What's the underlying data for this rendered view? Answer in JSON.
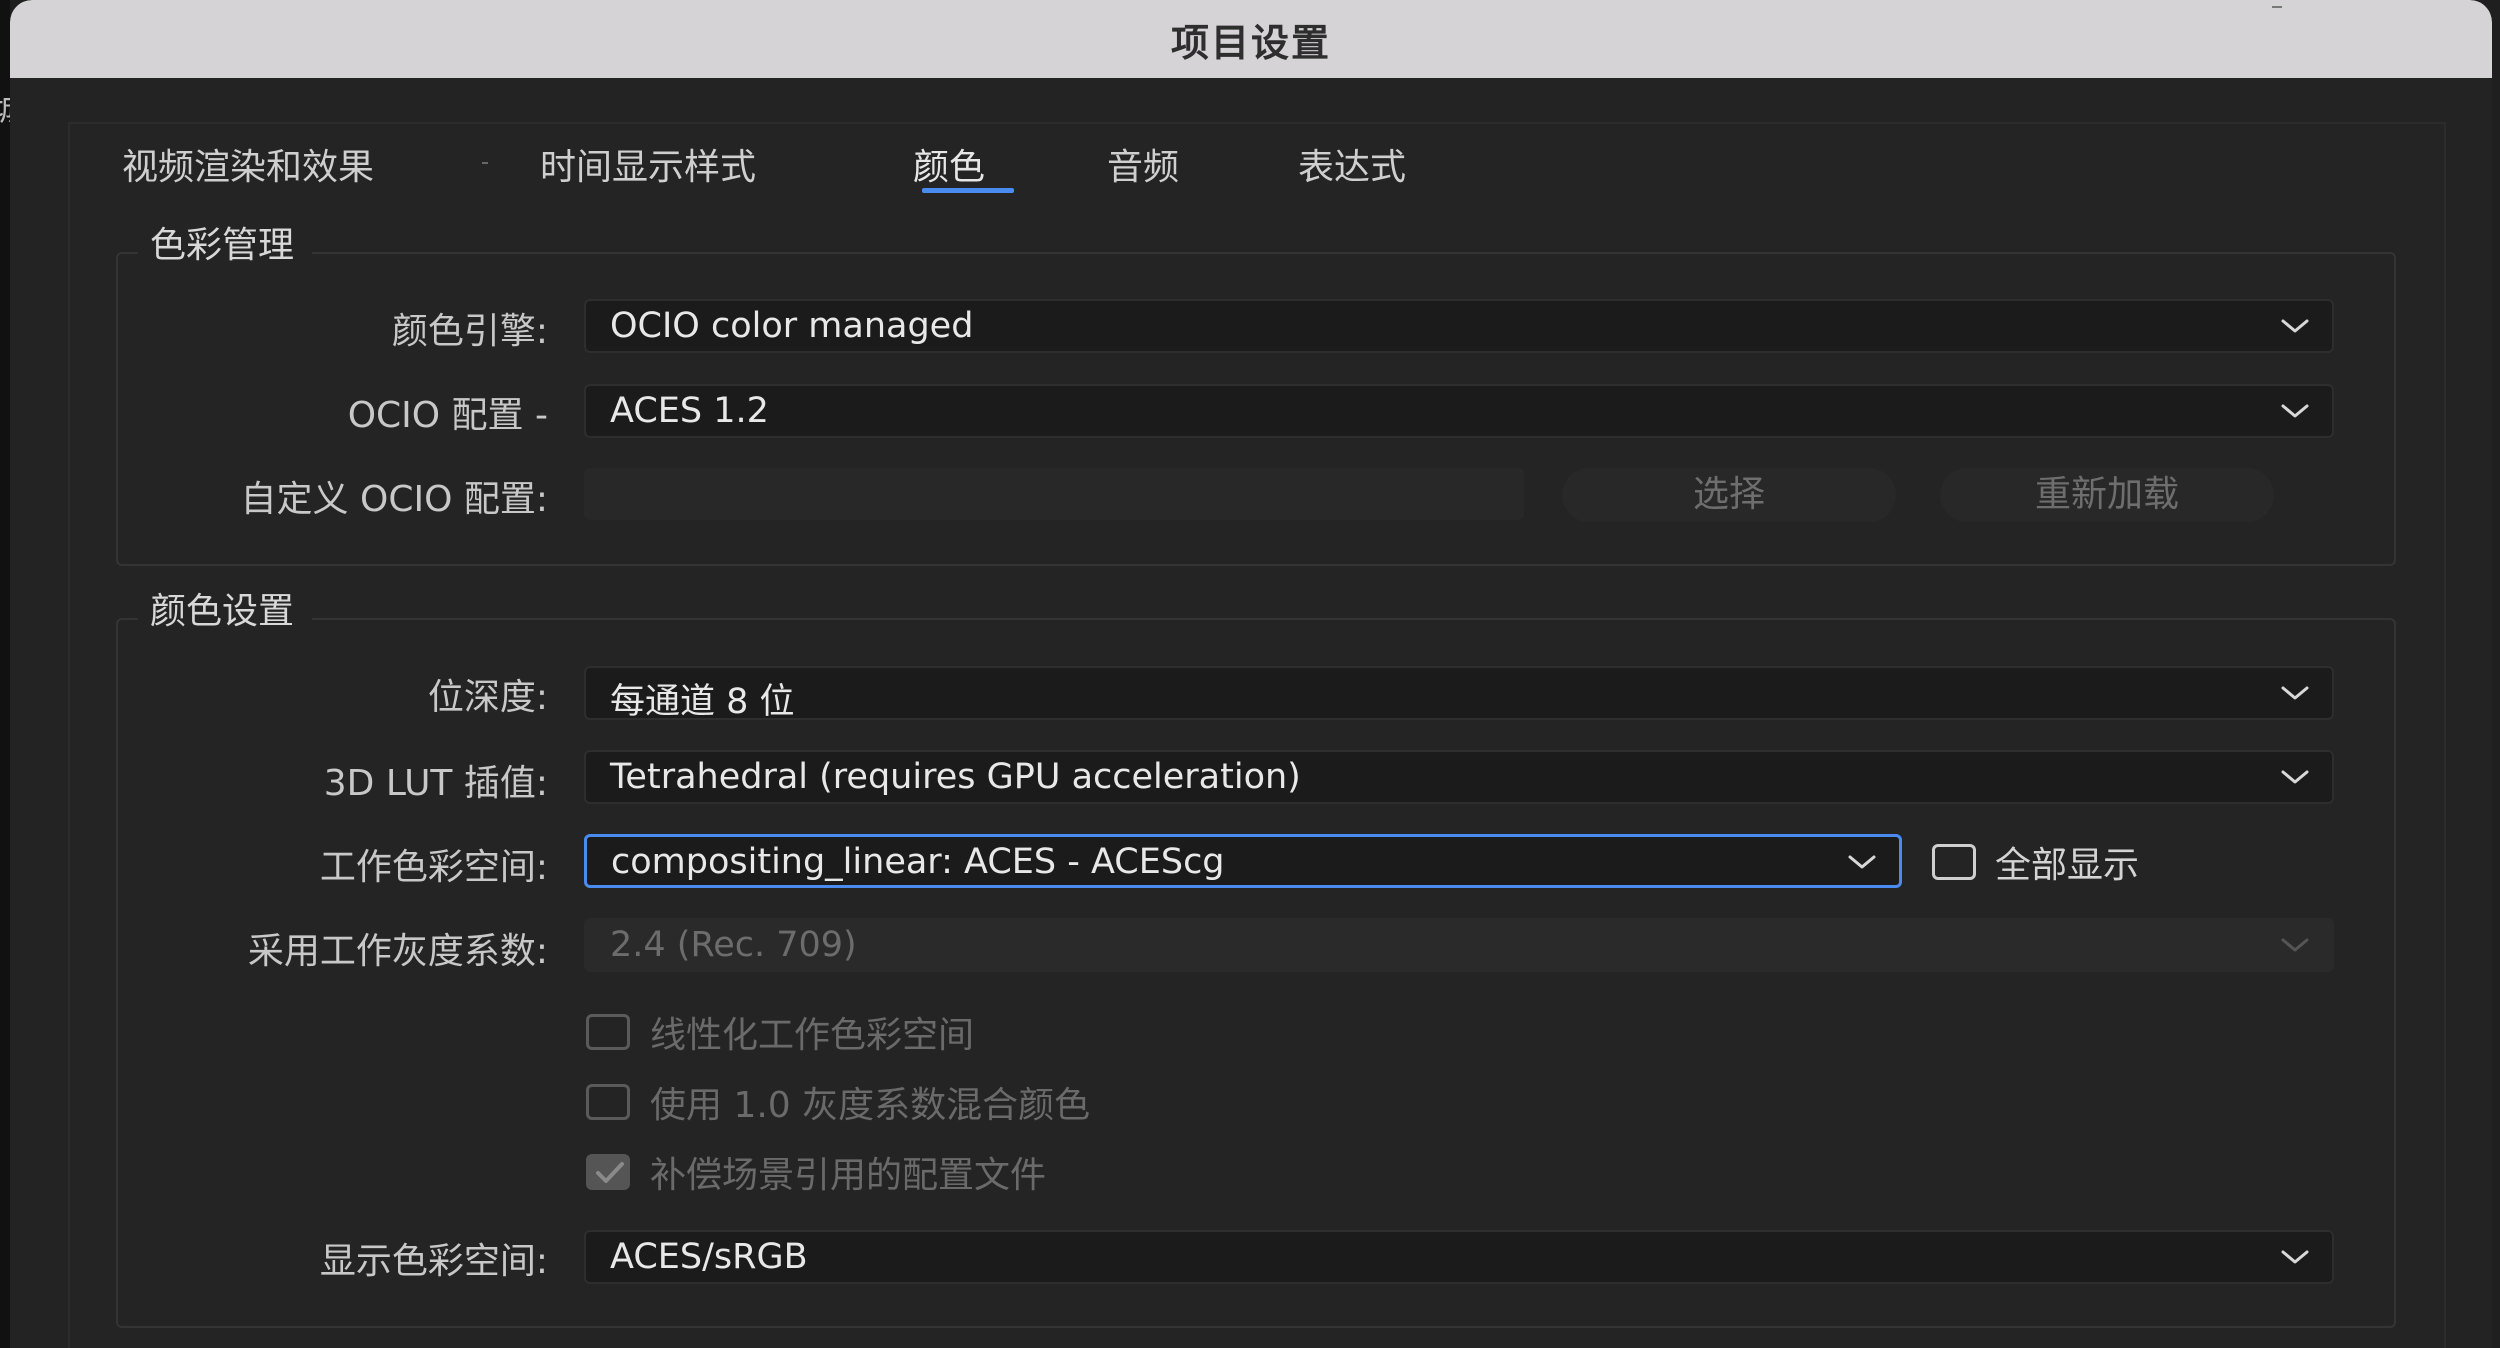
{
  "window": {
    "title": "项目设置",
    "left_edge_glyph": "城"
  },
  "tabs": [
    {
      "label": "视频渲染和效果",
      "active": false
    },
    {
      "label": "时间显示样式",
      "active": false
    },
    {
      "label": "颜色",
      "active": true
    },
    {
      "label": "音频",
      "active": false
    },
    {
      "label": "表达式",
      "active": false
    }
  ],
  "color_management": {
    "title": "色彩管理",
    "engine_label": "颜色引擎:",
    "engine_value": "OCIO color managed",
    "ocio_config_label": "OCIO 配置 -",
    "ocio_config_value": "ACES 1.2",
    "custom_config_label": "自定义 OCIO 配置:",
    "custom_config_value": "",
    "choose_button": "选择",
    "reload_button": "重新加载"
  },
  "color_settings": {
    "title": "颜色设置",
    "bit_depth_label": "位深度:",
    "bit_depth_value": "每通道 8 位",
    "lut_label": "3D LUT 插值:",
    "lut_value": "Tetrahedral (requires GPU acceleration)",
    "working_space_label": "工作色彩空间:",
    "working_space_value": "compositing_linear: ACES - ACEScg",
    "show_all_label": "全部显示",
    "show_all_checked": false,
    "gamma_label": "采用工作灰度系数:",
    "gamma_value": "2.4 (Rec. 709)",
    "linearize_label": "线性化工作色彩空间",
    "linearize_checked": false,
    "blend_gamma_label": "使用 1.0 灰度系数混合颜色",
    "blend_gamma_checked": false,
    "compensate_label": "补偿场景引用的配置文件",
    "compensate_checked": true,
    "display_space_label": "显示色彩空间:",
    "display_space_value": "ACES/sRGB"
  },
  "colors": {
    "accent": "#4a8bf0",
    "titlebar": "#d6d3d6",
    "panel": "#242424",
    "field": "#1b1b1b"
  }
}
